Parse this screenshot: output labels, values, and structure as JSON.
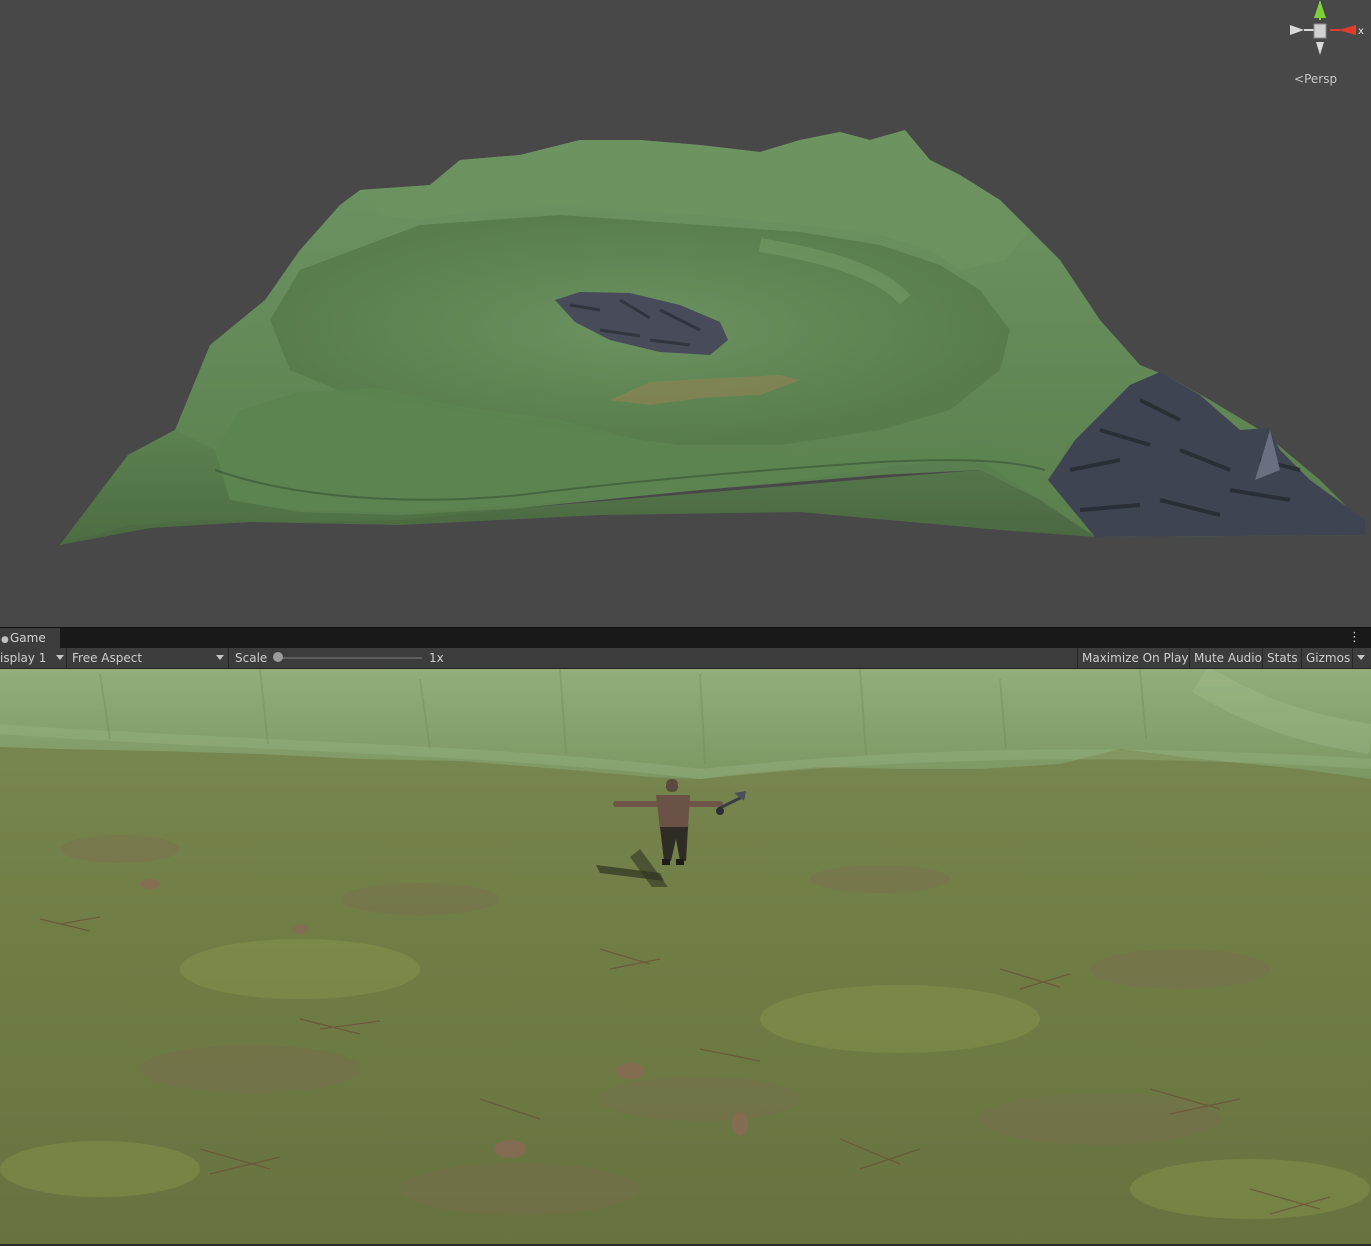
{
  "scene_view": {
    "projection_label": "Persp",
    "axis_x_label": "x"
  },
  "game_panel": {
    "tab_label": "Game",
    "display_label": "isplay 1",
    "aspect_label": "Free Aspect",
    "scale_label": "Scale",
    "scale_value_label": "1x",
    "maximize_label": "Maximize On Play",
    "mute_label": "Mute Audio",
    "stats_label": "Stats",
    "gizmos_label": "Gizmos"
  },
  "colors": {
    "editor_background": "#484848",
    "terrain_grass": "#5f8550",
    "terrain_rock": "#3d4350",
    "gizmo_x_axis": "#e23c2a",
    "gizmo_y_axis": "#7ed13a"
  },
  "icons": [
    "game-tab-icon",
    "kebab-menu-icon",
    "dropdown-arrow-icon",
    "scale-slider-thumb"
  ]
}
